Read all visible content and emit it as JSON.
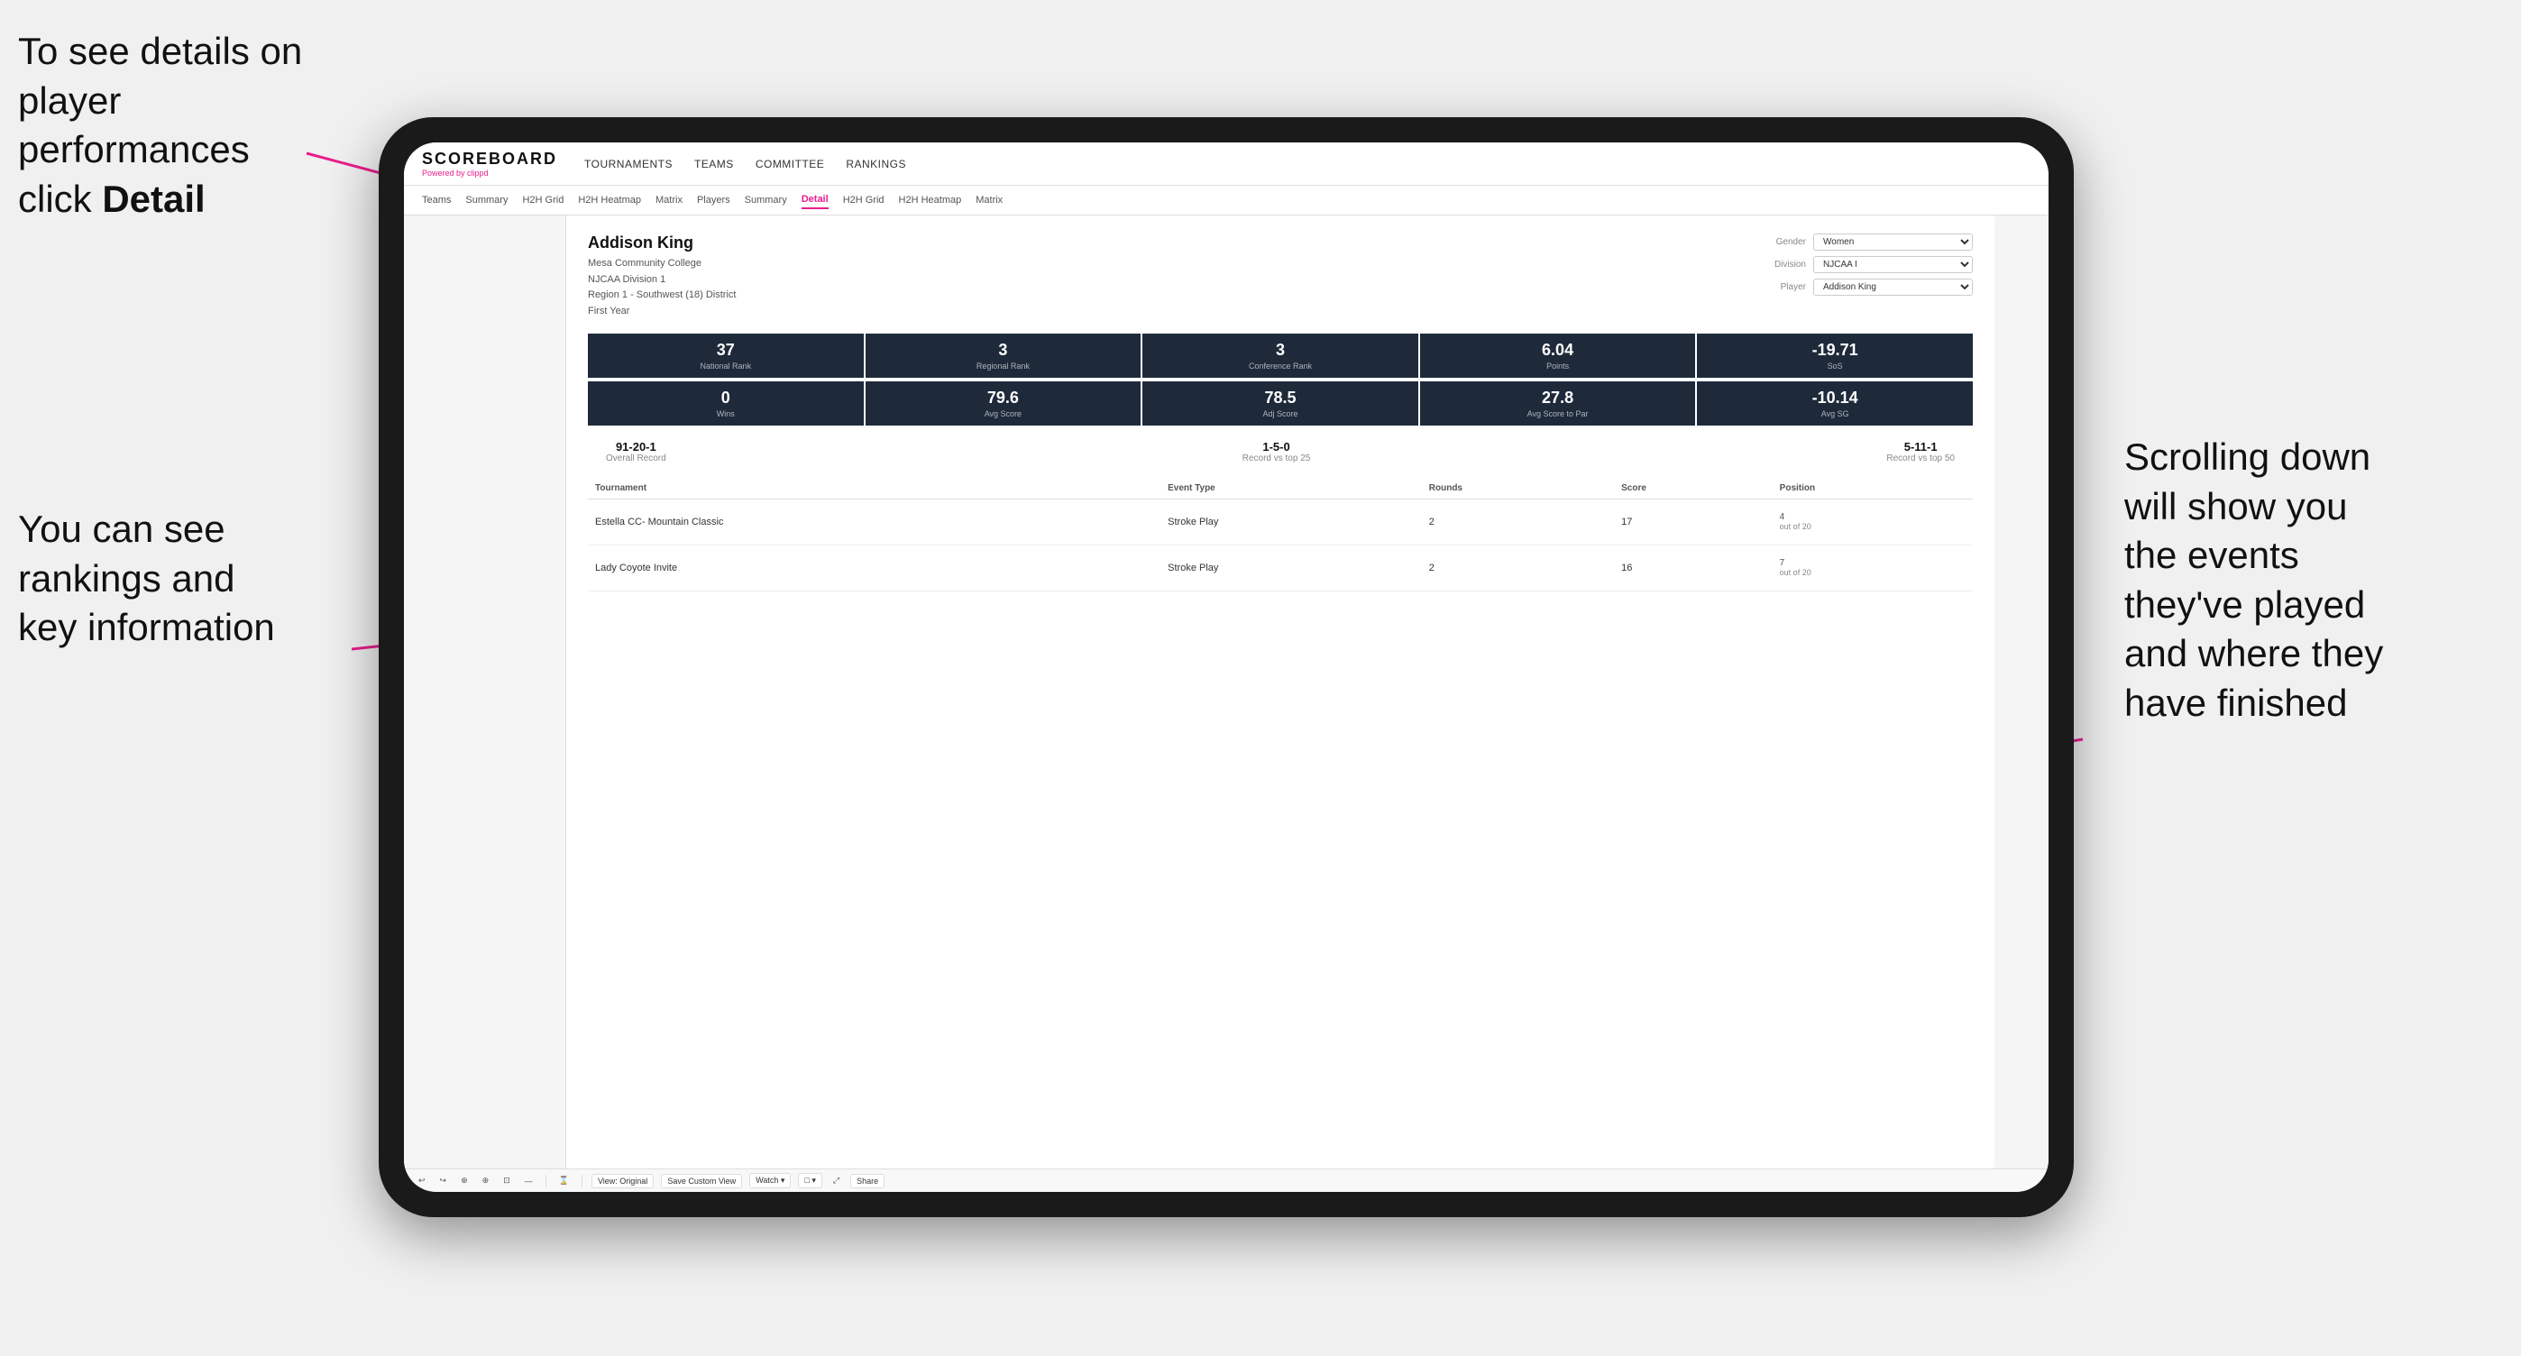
{
  "annotations": {
    "top_left_line1": "To see details on",
    "top_left_line2": "player performances",
    "top_left_line3": "click ",
    "top_left_bold": "Detail",
    "bottom_left_line1": "You can see",
    "bottom_left_line2": "rankings and",
    "bottom_left_line3": "key information",
    "right_line1": "Scrolling down",
    "right_line2": "will show you",
    "right_line3": "the events",
    "right_line4": "they've played",
    "right_line5": "and where they",
    "right_line6": "have finished"
  },
  "nav": {
    "logo": "SCOREBOARD",
    "logo_sub": "Powered by ",
    "logo_brand": "clippd",
    "items": [
      "TOURNAMENTS",
      "TEAMS",
      "COMMITTEE",
      "RANKINGS"
    ]
  },
  "sub_nav": {
    "items": [
      "Teams",
      "Summary",
      "H2H Grid",
      "H2H Heatmap",
      "Matrix",
      "Players",
      "Summary",
      "Detail",
      "H2H Grid",
      "H2H Heatmap",
      "Matrix"
    ],
    "active": "Detail"
  },
  "player": {
    "name": "Addison King",
    "college": "Mesa Community College",
    "division": "NJCAA Division 1",
    "region": "Region 1 - Southwest (18) District",
    "year": "First Year"
  },
  "controls": {
    "gender_label": "Gender",
    "gender_value": "Women",
    "division_label": "Division",
    "division_value": "NJCAA I",
    "player_label": "Player",
    "player_value": "Addison King"
  },
  "stats_row1": [
    {
      "value": "37",
      "label": "National Rank"
    },
    {
      "value": "3",
      "label": "Regional Rank"
    },
    {
      "value": "3",
      "label": "Conference Rank"
    },
    {
      "value": "6.04",
      "label": "Points"
    },
    {
      "value": "-19.71",
      "label": "SoS"
    }
  ],
  "stats_row2": [
    {
      "value": "0",
      "label": "Wins"
    },
    {
      "value": "79.6",
      "label": "Avg Score"
    },
    {
      "value": "78.5",
      "label": "Adj Score"
    },
    {
      "value": "27.8",
      "label": "Avg Score to Par"
    },
    {
      "value": "-10.14",
      "label": "Avg SG"
    }
  ],
  "records": [
    {
      "value": "91-20-1",
      "label": "Overall Record"
    },
    {
      "value": "1-5-0",
      "label": "Record vs top 25"
    },
    {
      "value": "5-11-1",
      "label": "Record vs top 50"
    }
  ],
  "table": {
    "headers": [
      "Tournament",
      "Event Type",
      "Rounds",
      "Score",
      "Position"
    ],
    "rows": [
      {
        "tournament": "Estella CC- Mountain Classic",
        "event_type": "Stroke Play",
        "rounds": "2",
        "score": "17",
        "position": "4\nout of 20"
      },
      {
        "tournament": "Lady Coyote Invite",
        "event_type": "Stroke Play",
        "rounds": "2",
        "score": "16",
        "position": "7\nout of 20"
      }
    ]
  },
  "toolbar": {
    "buttons": [
      "↩",
      "↪",
      "⊕",
      "⊕",
      "⊡",
      "—",
      "⌛",
      "View: Original",
      "Save Custom View",
      "Watch ▾",
      "□ ▾",
      "⤢",
      "Share"
    ]
  }
}
